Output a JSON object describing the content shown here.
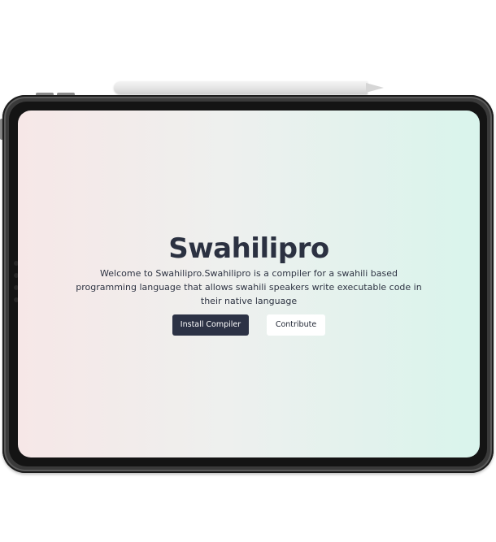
{
  "hero": {
    "title": "Swahilipro",
    "description": "Welcome to Swahilipro.Swahilipro is a compiler for a swahili based programming language that allows swahili speakers write executable code in their native language"
  },
  "actions": {
    "install_label": "Install Compiler",
    "contribute_label": "Contribute"
  },
  "colors": {
    "title_text": "#2b3141",
    "primary_button": "#2c3245",
    "secondary_button": "#ffffff",
    "gradient_left": "#f6e7e7",
    "gradient_right": "#d9f4ec",
    "device_frame": "#3a3a3a"
  }
}
